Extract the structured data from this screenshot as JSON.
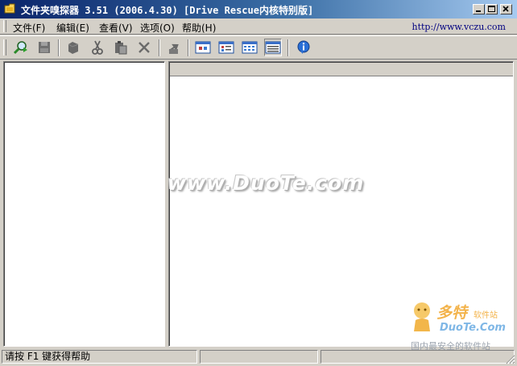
{
  "window": {
    "title": "文件夹嗅探器 3.51 (2006.4.30) [Drive Rescue内核特别版]"
  },
  "menu": {
    "items": [
      {
        "label": "文件(F)"
      },
      {
        "label": "编辑(E)"
      },
      {
        "label": "查看(V)"
      },
      {
        "label": "选项(O)"
      },
      {
        "label": "帮助(H)"
      }
    ],
    "url": "http://www.vczu.com"
  },
  "toolbar": {
    "buttons": [
      {
        "icon": "scan-search-icon"
      },
      {
        "icon": "save-disk-icon"
      },
      {
        "icon": "copy-files-icon"
      },
      {
        "icon": "cut-scissors-icon"
      },
      {
        "icon": "paste-icon"
      },
      {
        "icon": "delete-x-icon"
      },
      {
        "icon": "up-folder-icon"
      },
      {
        "icon": "large-icons-view-icon"
      },
      {
        "icon": "small-icons-view-icon"
      },
      {
        "icon": "list-view-icon"
      },
      {
        "icon": "details-view-icon"
      },
      {
        "icon": "about-info-icon"
      }
    ],
    "active_view": "details-view-icon"
  },
  "statusbar": {
    "text": "请按 F1 键获得帮助",
    "panel2": "",
    "panel3": ""
  },
  "watermark": {
    "center": "www.DuoTe.com",
    "logo_cn": "多特",
    "logo_cn_small": "软件站",
    "logo_en": "DuoTe.Com",
    "tagline": "国内最安全的软件站"
  },
  "colors": {
    "title_start": "#0a246a",
    "title_end": "#a6caf0",
    "face": "#d4d0c8",
    "url": "#000080"
  }
}
